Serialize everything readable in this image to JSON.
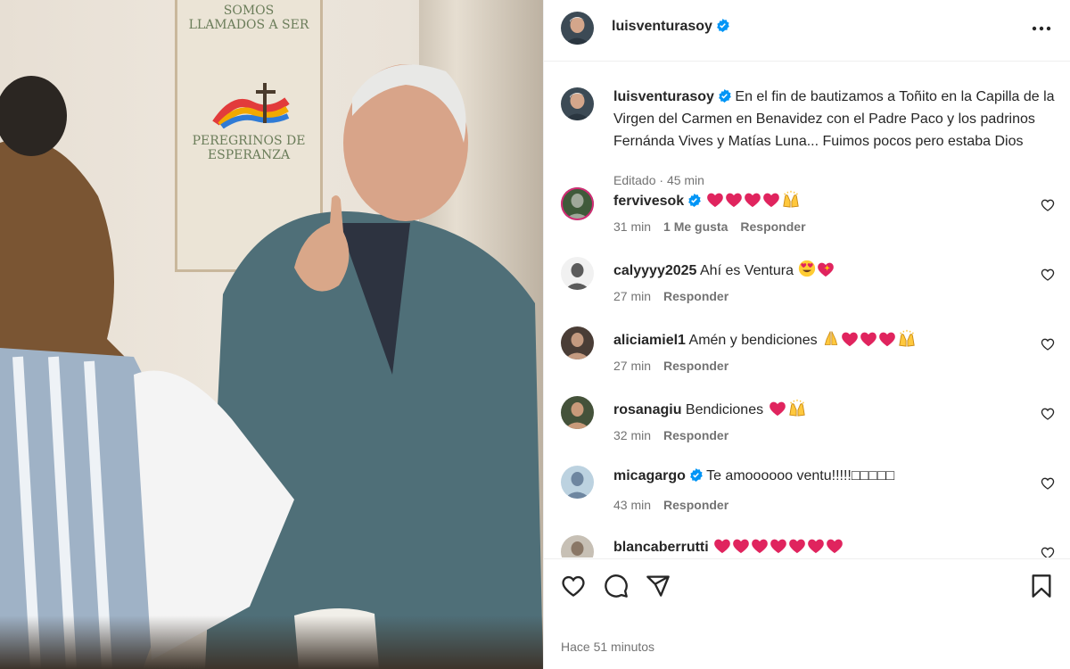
{
  "post": {
    "username": "luisventurasoy",
    "verified": true,
    "time_ago": "Hace 51 minutos"
  },
  "photo": {
    "banner_text_top": "SOMOS LLAMADOS A SER",
    "banner_text_bottom": "PEREGRINOS DE ESPERANZA"
  },
  "caption": {
    "username": "luisventurasoy",
    "text": "En el fin de bautizamos a Toñito en la Capilla de la Virgen del Carmen en Benavidez con el Padre Paco y los padrinos Fernánda Vives y Matías Luna... Fuimos pocos pero estaba Dios",
    "edited": "Editado",
    "time": "45 min"
  },
  "comments": [
    {
      "username": "fervivesok",
      "verified": true,
      "text": "",
      "emojis": [
        "heart",
        "heart",
        "heart",
        "heart",
        "praise"
      ],
      "time": "31 min",
      "likes": "1 Me gusta",
      "reply": "Responder"
    },
    {
      "username": "calyyyy2025",
      "verified": false,
      "text": "Ahí es Ventura",
      "emojis": [
        "heart-eyes",
        "heart-sparkle"
      ],
      "time": "27 min",
      "likes": "",
      "reply": "Responder"
    },
    {
      "username": "aliciamiel1",
      "verified": false,
      "text": "Amén y bendiciones",
      "emojis": [
        "pray",
        "heart",
        "heart",
        "heart",
        "praise"
      ],
      "time": "27 min",
      "likes": "",
      "reply": "Responder"
    },
    {
      "username": "rosanagiu",
      "verified": false,
      "text": "Bendiciones",
      "emojis": [
        "heart",
        "praise"
      ],
      "time": "32 min",
      "likes": "",
      "reply": "Responder"
    },
    {
      "username": "micagargo",
      "verified": true,
      "text": "Te amoooooo ventu!!!!!□□□□□",
      "emojis": [],
      "time": "43 min",
      "likes": "",
      "reply": "Responder"
    },
    {
      "username": "blancaberrutti",
      "verified": false,
      "text": "",
      "emojis": [
        "heart",
        "heart",
        "heart",
        "heart",
        "heart",
        "heart",
        "heart"
      ],
      "time": "",
      "likes": "",
      "reply": ""
    }
  ],
  "icons": {
    "more": "more-horizontal-icon",
    "like": "heart-outline-icon",
    "comment": "comment-bubble-icon",
    "share": "paper-plane-icon",
    "save": "bookmark-icon",
    "verified": "verified-badge-icon"
  },
  "colors": {
    "verified_blue": "#0095f6",
    "text_primary": "#262626",
    "text_secondary": "#737373",
    "heart_red": "#e0245e"
  }
}
